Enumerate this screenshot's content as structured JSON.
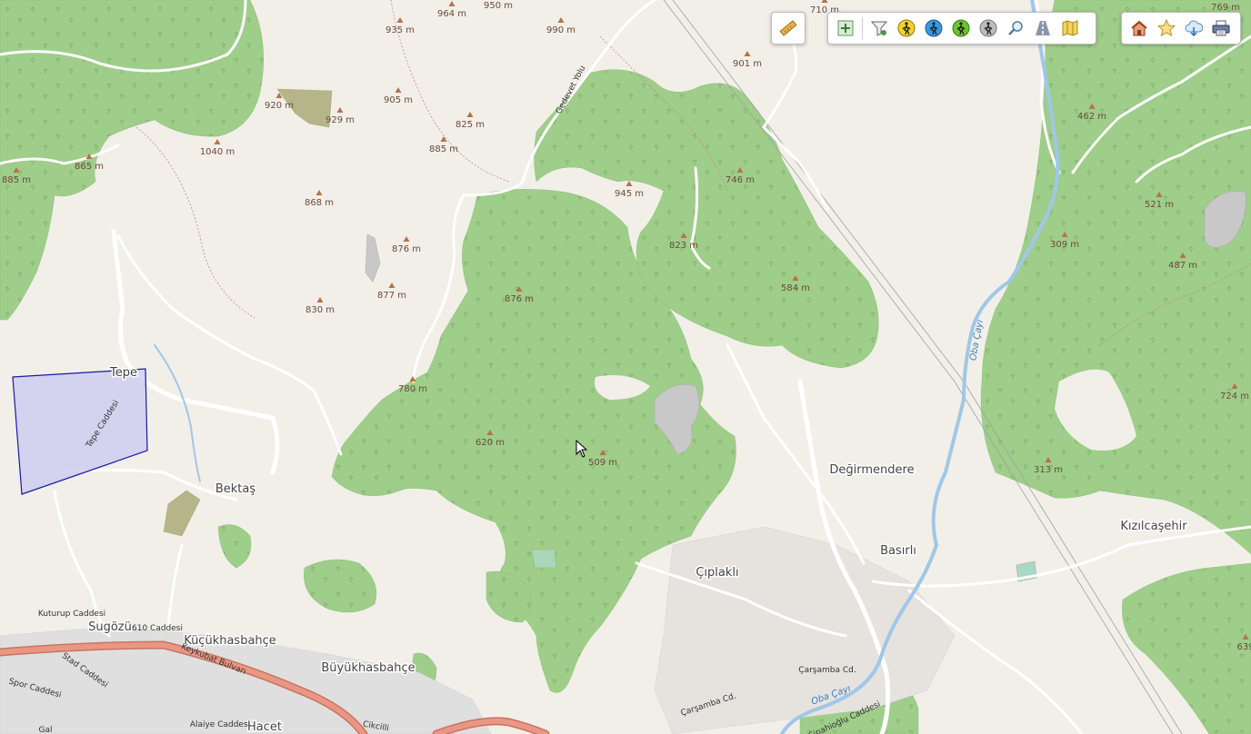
{
  "toolbar_left": {
    "measure_icon": "ruler-icon"
  },
  "toolbar_mid": {
    "items": [
      {
        "name": "add-layer-icon"
      },
      {
        "name": "filter-icon"
      },
      {
        "name": "hiking-yellow-icon"
      },
      {
        "name": "hiking-blue-icon"
      },
      {
        "name": "hiking-green-icon"
      },
      {
        "name": "hiking-grey-icon"
      },
      {
        "name": "search-icon"
      },
      {
        "name": "road-icon"
      },
      {
        "name": "map-icon"
      }
    ]
  },
  "toolbar_right": {
    "items": [
      {
        "name": "home-icon"
      },
      {
        "name": "star-icon"
      },
      {
        "name": "cloud-download-icon"
      },
      {
        "name": "print-icon"
      }
    ]
  },
  "colors": {
    "background": "#f2efe9",
    "forest": "#9fcd8a",
    "forest_dark": "#8dc27a",
    "river": "#9fc7e8",
    "highway": "#e99784",
    "polygon": "#c8c8f0",
    "polygon_stroke": "#1a1aa0",
    "quarry": "#c5c5c5",
    "peak": "#b7724a"
  },
  "peaks": [
    {
      "label": "950 m"
    },
    {
      "label": "964 m"
    },
    {
      "label": "935 m"
    },
    {
      "label": "990 m"
    },
    {
      "label": "710 m"
    },
    {
      "label": "769 m"
    },
    {
      "label": "901 m"
    },
    {
      "label": "920 m"
    },
    {
      "label": "929 m"
    },
    {
      "label": "905 m"
    },
    {
      "label": "825 m"
    },
    {
      "label": "885 m"
    },
    {
      "label": "1040 m"
    },
    {
      "label": "865 m"
    },
    {
      "label": "885 m"
    },
    {
      "label": "462 m"
    },
    {
      "label": "945 m"
    },
    {
      "label": "746 m"
    },
    {
      "label": "868 m"
    },
    {
      "label": "521 m"
    },
    {
      "label": "876 m"
    },
    {
      "label": "823 m"
    },
    {
      "label": "309 m"
    },
    {
      "label": "487 m"
    },
    {
      "label": "877 m"
    },
    {
      "label": "876 m"
    },
    {
      "label": "584 m"
    },
    {
      "label": "830 m"
    },
    {
      "label": "780 m"
    },
    {
      "label": "724 m"
    },
    {
      "label": "620 m"
    },
    {
      "label": "509 m"
    },
    {
      "label": "313 m"
    },
    {
      "label": "639"
    }
  ],
  "places": [
    {
      "label": "Tepe"
    },
    {
      "label": "Bektaş"
    },
    {
      "label": "Değirmendere"
    },
    {
      "label": "Kızılcaşehir"
    },
    {
      "label": "Basırlı"
    },
    {
      "label": "Çıplaklı"
    },
    {
      "label": "Sugözü"
    },
    {
      "label": "Küçükhasbahçe"
    },
    {
      "label": "Büyükhasbahçe"
    },
    {
      "label": "Hacet"
    }
  ],
  "roads": [
    {
      "label": "Gedevet Yolu"
    },
    {
      "label": "Tepe Caddesi"
    },
    {
      "label": "Kuturup Caddesi"
    },
    {
      "label": "610 Caddesi"
    },
    {
      "label": "Keykubat Bulvarı"
    },
    {
      "label": "Stad Caddesi"
    },
    {
      "label": "Spor Caddesi"
    },
    {
      "label": "Alaiye Caddesi"
    },
    {
      "label": "Cikcilli"
    },
    {
      "label": "Çarşamba Cd."
    },
    {
      "label": "Çarşamba Cd."
    },
    {
      "label": "Sipahioğlu Caddesi"
    },
    {
      "label": "Gal"
    }
  ],
  "waters": [
    {
      "label": "Oba Çayı"
    },
    {
      "label": "Oba Çayı"
    }
  ]
}
